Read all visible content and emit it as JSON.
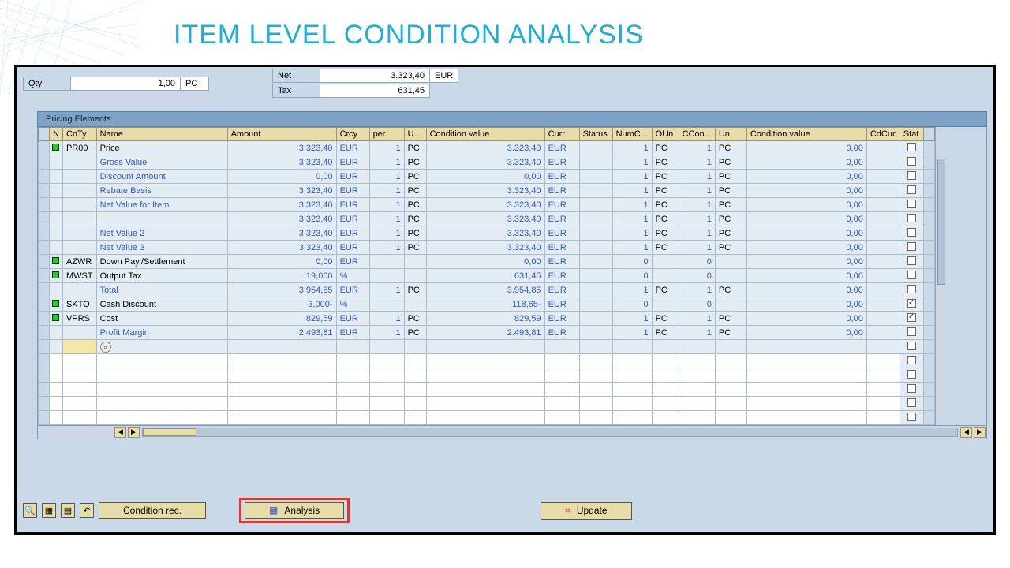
{
  "title": "ITEM LEVEL CONDITION ANALYSIS",
  "top": {
    "qty_label": "Qty",
    "qty_value": "1,00",
    "qty_unit": "PC",
    "net_label": "Net",
    "net_value": "3.323,40",
    "net_curr": "EUR",
    "tax_label": "Tax",
    "tax_value": "631,45"
  },
  "section_title": "Pricing Elements",
  "headers": {
    "n": "N",
    "cnty": "CnTy",
    "name": "Name",
    "amount": "Amount",
    "crcy": "Crcy",
    "per": "per",
    "u": "U...",
    "condval": "Condition value",
    "curr": "Curr.",
    "status": "Status",
    "numc": "NumC...",
    "oun": "OUn",
    "ccon": "CCon...",
    "un": "Un",
    "condval2": "Condition value",
    "cdcur": "CdCur",
    "stat": "Stat"
  },
  "rows": [
    {
      "flag": true,
      "cnty": "PR00",
      "name": "Price",
      "cls": "txt",
      "amt": "3.323,40",
      "crcy": "EUR",
      "per": "1",
      "u": "PC",
      "cv": "3.323,40",
      "curr": "EUR",
      "numc": "1",
      "oun": "PC",
      "ccon": "1",
      "un": "PC",
      "cv2": "0,00",
      "stat": false
    },
    {
      "flag": false,
      "cnty": "",
      "name": "Gross Value",
      "cls": "txt-blue",
      "amt": "3.323,40",
      "crcy": "EUR",
      "per": "1",
      "u": "PC",
      "cv": "3.323,40",
      "curr": "EUR",
      "numc": "1",
      "oun": "PC",
      "ccon": "1",
      "un": "PC",
      "cv2": "0,00",
      "stat": false
    },
    {
      "flag": false,
      "cnty": "",
      "name": "Discount Amount",
      "cls": "txt-blue",
      "amt": "0,00",
      "crcy": "EUR",
      "per": "1",
      "u": "PC",
      "cv": "0,00",
      "curr": "EUR",
      "numc": "1",
      "oun": "PC",
      "ccon": "1",
      "un": "PC",
      "cv2": "0,00",
      "stat": false
    },
    {
      "flag": false,
      "cnty": "",
      "name": "Rebate Basis",
      "cls": "txt-blue",
      "amt": "3.323,40",
      "crcy": "EUR",
      "per": "1",
      "u": "PC",
      "cv": "3.323,40",
      "curr": "EUR",
      "numc": "1",
      "oun": "PC",
      "ccon": "1",
      "un": "PC",
      "cv2": "0,00",
      "stat": false
    },
    {
      "flag": false,
      "cnty": "",
      "name": "Net Value for Item",
      "cls": "txt-blue",
      "amt": "3.323,40",
      "crcy": "EUR",
      "per": "1",
      "u": "PC",
      "cv": "3.323,40",
      "curr": "EUR",
      "numc": "1",
      "oun": "PC",
      "ccon": "1",
      "un": "PC",
      "cv2": "0,00",
      "stat": false
    },
    {
      "flag": false,
      "cnty": "",
      "name": "",
      "cls": "txt-blue",
      "amt": "3.323,40",
      "crcy": "EUR",
      "per": "1",
      "u": "PC",
      "cv": "3.323,40",
      "curr": "EUR",
      "numc": "1",
      "oun": "PC",
      "ccon": "1",
      "un": "PC",
      "cv2": "0,00",
      "stat": false
    },
    {
      "flag": false,
      "cnty": "",
      "name": "Net Value 2",
      "cls": "txt-blue",
      "amt": "3.323,40",
      "crcy": "EUR",
      "per": "1",
      "u": "PC",
      "cv": "3.323,40",
      "curr": "EUR",
      "numc": "1",
      "oun": "PC",
      "ccon": "1",
      "un": "PC",
      "cv2": "0,00",
      "stat": false
    },
    {
      "flag": false,
      "cnty": "",
      "name": "Net Value 3",
      "cls": "txt-blue",
      "amt": "3.323,40",
      "crcy": "EUR",
      "per": "1",
      "u": "PC",
      "cv": "3.323,40",
      "curr": "EUR",
      "numc": "1",
      "oun": "PC",
      "ccon": "1",
      "un": "PC",
      "cv2": "0,00",
      "stat": false
    },
    {
      "flag": true,
      "cnty": "AZWR",
      "name": "Down Pay./Settlement",
      "cls": "txt",
      "amt": "0,00",
      "crcy": "EUR",
      "per": "",
      "u": "",
      "cv": "0,00",
      "curr": "EUR",
      "numc": "0",
      "oun": "",
      "ccon": "0",
      "un": "",
      "cv2": "0,00",
      "stat": false
    },
    {
      "flag": true,
      "cnty": "MWST",
      "name": "Output Tax",
      "cls": "txt",
      "amt": "19,000",
      "crcy": "%",
      "per": "",
      "u": "",
      "cv": "631,45",
      "curr": "EUR",
      "numc": "0",
      "oun": "",
      "ccon": "0",
      "un": "",
      "cv2": "0,00",
      "stat": false
    },
    {
      "flag": false,
      "cnty": "",
      "name": "Total",
      "cls": "txt-blue",
      "amt": "3.954,85",
      "crcy": "EUR",
      "per": "1",
      "u": "PC",
      "cv": "3.954,85",
      "curr": "EUR",
      "numc": "1",
      "oun": "PC",
      "ccon": "1",
      "un": "PC",
      "cv2": "0,00",
      "stat": false
    },
    {
      "flag": true,
      "cnty": "SKTO",
      "name": "Cash Discount",
      "cls": "txt",
      "amt": "3,000-",
      "crcy": "%",
      "per": "",
      "u": "",
      "cv": "118,65-",
      "curr": "EUR",
      "numc": "0",
      "oun": "",
      "ccon": "0",
      "un": "",
      "cv2": "0,00",
      "stat": true
    },
    {
      "flag": true,
      "cnty": "VPRS",
      "name": "Cost",
      "cls": "txt",
      "amt": "829,59",
      "crcy": "EUR",
      "per": "1",
      "u": "PC",
      "cv": "829,59",
      "curr": "EUR",
      "numc": "1",
      "oun": "PC",
      "ccon": "1",
      "un": "PC",
      "cv2": "0,00",
      "stat": true
    },
    {
      "flag": false,
      "cnty": "",
      "name": "Profit Margin",
      "cls": "txt-blue",
      "amt": "2.493,81",
      "crcy": "EUR",
      "per": "1",
      "u": "PC",
      "cv": "2.493,81",
      "curr": "EUR",
      "numc": "1",
      "oun": "PC",
      "ccon": "1",
      "un": "PC",
      "cv2": "0,00",
      "stat": false
    }
  ],
  "buttons": {
    "condition_rec": "Condition rec.",
    "analysis": "Analysis",
    "update": "Update"
  }
}
